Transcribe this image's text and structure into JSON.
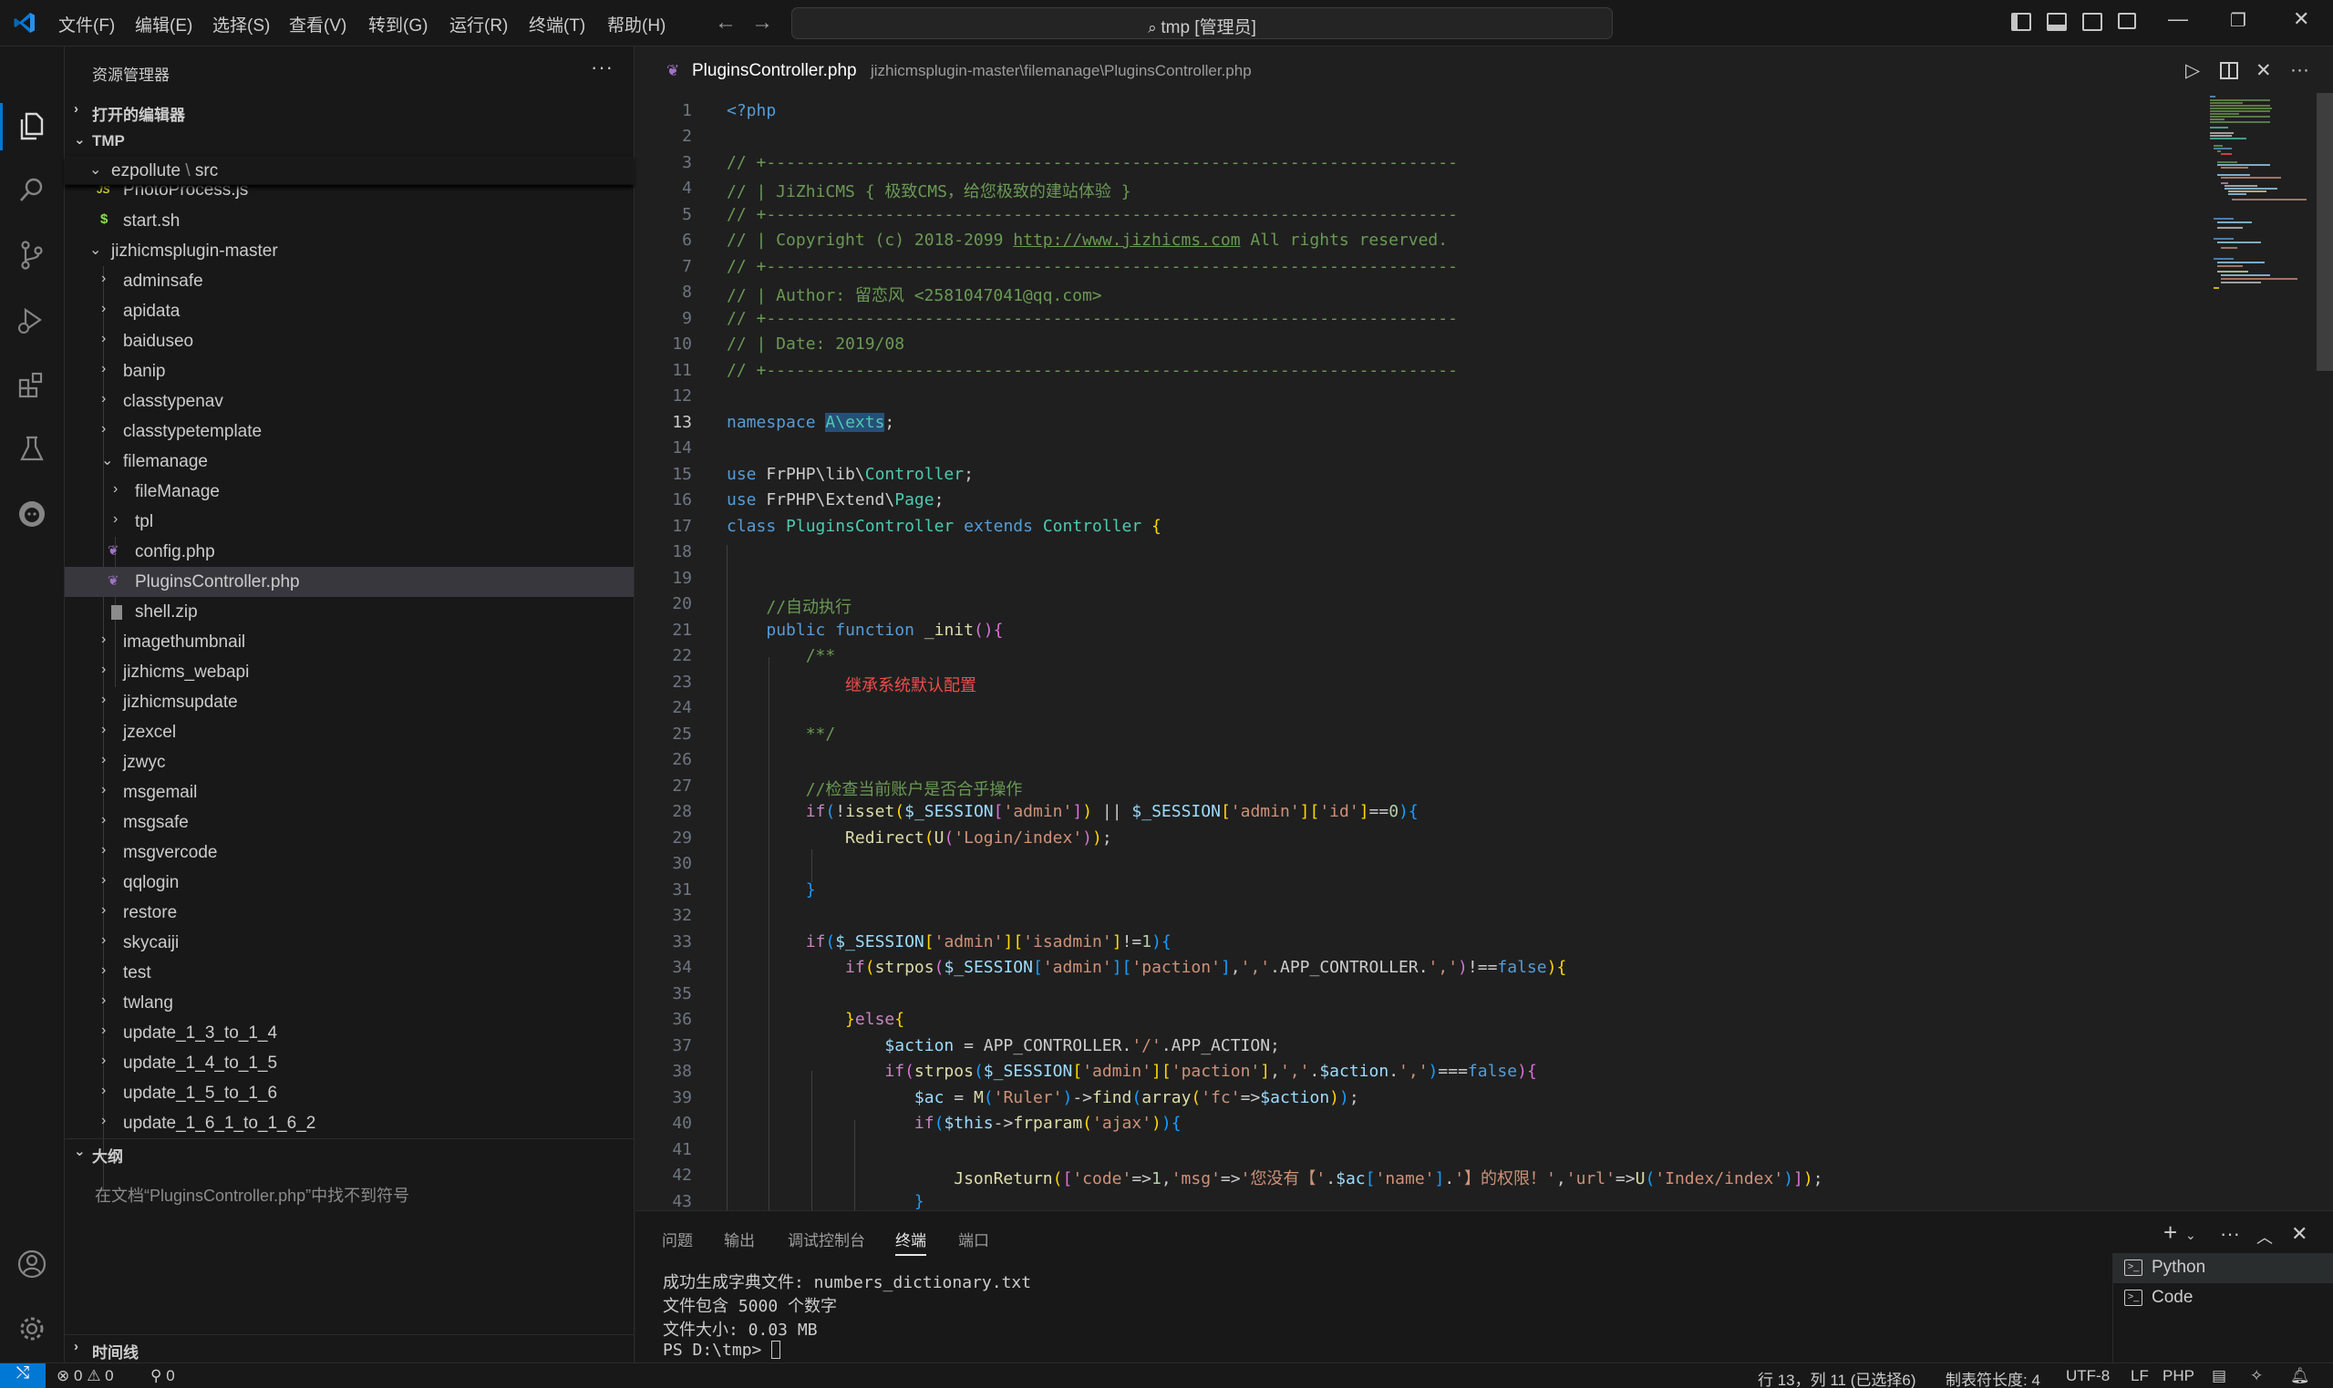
{
  "titlebar": {
    "menus": [
      "文件(F)",
      "编辑(E)",
      "选择(S)",
      "查看(V)",
      "转到(G)",
      "运行(R)",
      "终端(T)",
      "帮助(H)"
    ],
    "search": "tmp [管理员]"
  },
  "activitybar": {
    "icons": [
      "explorer-icon",
      "search-icon",
      "source-control-icon",
      "run-debug-icon",
      "extensions-icon",
      "testing-icon",
      "remote-icon",
      "account-icon",
      "settings-gear-icon"
    ]
  },
  "sidebar": {
    "title": "资源管理器",
    "more": "···",
    "sections": {
      "open_editors": "打开的编辑器",
      "workspace": "TMP",
      "outline": "大纲",
      "timeline": "时间线"
    },
    "sticky_folder": "ezpollute",
    "sticky_sep": "\\",
    "sticky_sub": "src",
    "tree": [
      {
        "label": "PhotoProcess.js",
        "icon": "JS",
        "type": "file"
      },
      {
        "label": "start.sh",
        "icon": "$",
        "type": "file"
      },
      {
        "label": "jizhicmsplugin-master",
        "type": "folder-open"
      },
      {
        "label": "adminsafe",
        "type": "folder"
      },
      {
        "label": "apidata",
        "type": "folder"
      },
      {
        "label": "baiduseo",
        "type": "folder"
      },
      {
        "label": "banip",
        "type": "folder"
      },
      {
        "label": "classtypenav",
        "type": "folder"
      },
      {
        "label": "classtypetemplate",
        "type": "folder"
      },
      {
        "label": "filemanage",
        "type": "folder-open"
      },
      {
        "label": "fileManage",
        "type": "folder"
      },
      {
        "label": "tpl",
        "type": "folder"
      },
      {
        "label": "config.php",
        "icon": "php",
        "type": "file"
      },
      {
        "label": "PluginsController.php",
        "icon": "php",
        "type": "file"
      },
      {
        "label": "shell.zip",
        "icon": "zip",
        "type": "file"
      },
      {
        "label": "imagethumbnail",
        "type": "folder"
      },
      {
        "label": "jizhicms_webapi",
        "type": "folder"
      },
      {
        "label": "jizhicmsupdate",
        "type": "folder"
      },
      {
        "label": "jzexcel",
        "type": "folder"
      },
      {
        "label": "jzwyc",
        "type": "folder"
      },
      {
        "label": "msgemail",
        "type": "folder"
      },
      {
        "label": "msgsafe",
        "type": "folder"
      },
      {
        "label": "msgvercode",
        "type": "folder"
      },
      {
        "label": "qqlogin",
        "type": "folder"
      },
      {
        "label": "restore",
        "type": "folder"
      },
      {
        "label": "skycaiji",
        "type": "folder"
      },
      {
        "label": "test",
        "type": "folder"
      },
      {
        "label": "twlang",
        "type": "folder"
      },
      {
        "label": "update_1_3_to_1_4",
        "type": "folder"
      },
      {
        "label": "update_1_4_to_1_5",
        "type": "folder"
      },
      {
        "label": "update_1_5_to_1_6",
        "type": "folder"
      },
      {
        "label": "update_1_6_1_to_1_6_2",
        "type": "folder"
      }
    ],
    "outline_empty": "在文档“PluginsController.php”中找不到符号"
  },
  "editor": {
    "tab_title": "PluginsController.php",
    "tab_path": "jizhicmsplugin-master\\filemanage\\PluginsController.php",
    "active_line": 13
  },
  "panel": {
    "tabs": [
      "问题",
      "输出",
      "调试控制台",
      "终端",
      "端口"
    ],
    "active_tab": "终端",
    "terminal_lines": [
      "成功生成字典文件: numbers_dictionary.txt",
      "文件包含 5000 个数字",
      "文件大小: 0.03 MB",
      "PS D:\\tmp> "
    ],
    "terminals": [
      "Python",
      "Code"
    ]
  },
  "statusbar": {
    "errors": "0",
    "warnings": "0",
    "ports": "0",
    "position": "行 13，列 11 (已选择6)",
    "tab_size": "制表符长度: 4",
    "encoding": "UTF-8",
    "eol": "LF",
    "language": "PHP"
  },
  "colors": {
    "accent": "#0078d4",
    "background": "#1f1f1f",
    "sidebar": "#181818"
  }
}
